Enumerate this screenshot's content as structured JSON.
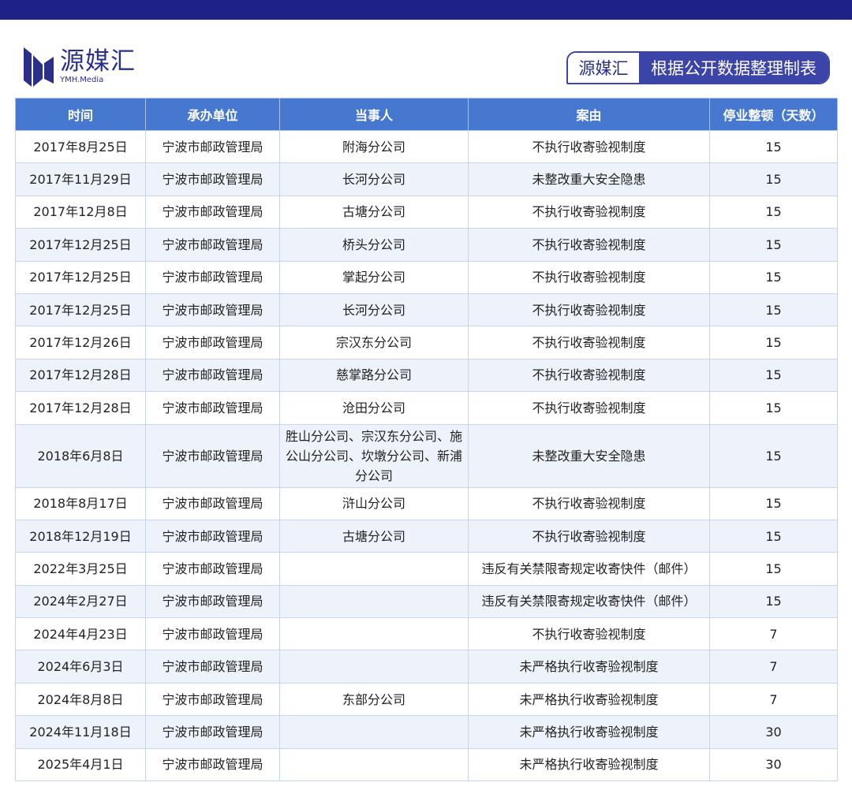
{
  "header": {
    "logo_cn": "源媒汇",
    "logo_en": "YMH.Media",
    "badge_left": "源媒汇",
    "badge_right": "根据公开数据整理制表",
    "accent": "#1e2188"
  },
  "table": {
    "columns": [
      "时间",
      "承办单位",
      "当事人",
      "案由",
      "停业整顿（天数）"
    ],
    "rows": [
      [
        "2017年8月25日",
        "宁波市邮政管理局",
        "附海分公司",
        "不执行收寄验视制度",
        "15"
      ],
      [
        "2017年11月29日",
        "宁波市邮政管理局",
        "长河分公司",
        "未整改重大安全隐患",
        "15"
      ],
      [
        "2017年12月8日",
        "宁波市邮政管理局",
        "古塘分公司",
        "不执行收寄验视制度",
        "15"
      ],
      [
        "2017年12月25日",
        "宁波市邮政管理局",
        "桥头分公司",
        "不执行收寄验视制度",
        "15"
      ],
      [
        "2017年12月25日",
        "宁波市邮政管理局",
        "掌起分公司",
        "不执行收寄验视制度",
        "15"
      ],
      [
        "2017年12月25日",
        "宁波市邮政管理局",
        "长河分公司",
        "不执行收寄验视制度",
        "15"
      ],
      [
        "2017年12月26日",
        "宁波市邮政管理局",
        "宗汉东分公司",
        "不执行收寄验视制度",
        "15"
      ],
      [
        "2017年12月28日",
        "宁波市邮政管理局",
        "慈掌路分公司",
        "不执行收寄验视制度",
        "15"
      ],
      [
        "2017年12月28日",
        "宁波市邮政管理局",
        "沧田分公司",
        "不执行收寄验视制度",
        "15"
      ],
      [
        "2018年6月8日",
        "宁波市邮政管理局",
        "胜山分公司、宗汉东分公司、施公山分公司、坎墩分公司、新浦分公司",
        "未整改重大安全隐患",
        "15"
      ],
      [
        "2018年8月17日",
        "宁波市邮政管理局",
        "浒山分公司",
        "不执行收寄验视制度",
        "15"
      ],
      [
        "2018年12月19日",
        "宁波市邮政管理局",
        "古塘分公司",
        "不执行收寄验视制度",
        "15"
      ],
      [
        "2022年3月25日",
        "宁波市邮政管理局",
        "",
        "违反有关禁限寄规定收寄快件（邮件）",
        "15"
      ],
      [
        "2024年2月27日",
        "宁波市邮政管理局",
        "",
        "违反有关禁限寄规定收寄快件（邮件）",
        "15"
      ],
      [
        "2024年4月23日",
        "宁波市邮政管理局",
        "",
        "不执行收寄验视制度",
        "7"
      ],
      [
        "2024年6月3日",
        "宁波市邮政管理局",
        "",
        "未严格执行收寄验视制度",
        "7"
      ],
      [
        "2024年8月8日",
        "宁波市邮政管理局",
        "东部分公司",
        "未严格执行收寄验视制度",
        "7"
      ],
      [
        "2024年11月18日",
        "宁波市邮政管理局",
        "",
        "未严格执行收寄验视制度",
        "30"
      ],
      [
        "2025年4月1日",
        "宁波市邮政管理局",
        "",
        "未严格执行收寄验视制度",
        "30"
      ]
    ]
  }
}
